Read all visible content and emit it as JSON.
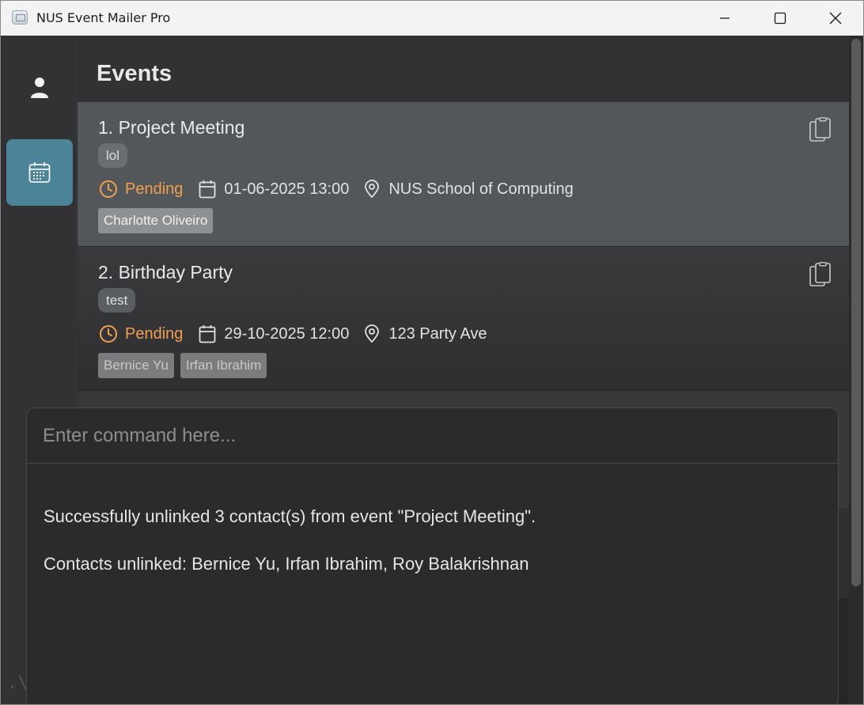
{
  "window": {
    "title": "NUS Event Mailer Pro",
    "icons": {
      "app": "app-mail-icon",
      "minimize": "minimize-icon",
      "maximize": "maximize-icon",
      "close": "close-icon"
    }
  },
  "sidebar": {
    "items": [
      {
        "name": "contacts",
        "icon": "person-icon",
        "active": false
      },
      {
        "name": "events",
        "icon": "calendar-icon",
        "active": true
      }
    ]
  },
  "main": {
    "title": "Events",
    "events": [
      {
        "title": "1. Project Meeting",
        "tag": "lol",
        "status": "Pending",
        "datetime": "01-06-2025 13:00",
        "location": "NUS School of Computing",
        "contacts": [
          "Charlotte Oliveiro"
        ],
        "selected": true
      },
      {
        "title": "2. Birthday Party",
        "tag": "test",
        "status": "Pending",
        "datetime": "29-10-2025 12:00",
        "location": "123 Party Ave",
        "contacts": [
          "Bernice Yu",
          "Irfan Ibrahim"
        ],
        "selected": false
      }
    ]
  },
  "command": {
    "placeholder": "Enter command here...",
    "value": "",
    "output_line1": "Successfully unlinked 3 contact(s) from event \"Project Meeting\".",
    "output_line2": "Contacts unlinked: Bernice Yu, Irfan Ibrahim, Roy Balakrishnan"
  },
  "footer": {
    "path_hint": ".\\d"
  },
  "colors": {
    "accent": "#4b8499",
    "status_pending": "#f0a050",
    "selected_card": "#545759"
  }
}
